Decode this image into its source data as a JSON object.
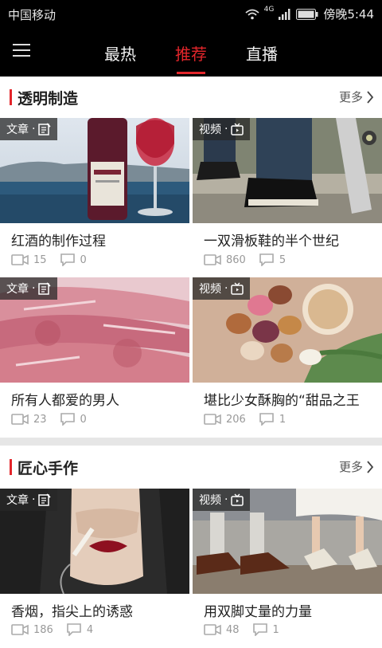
{
  "status_bar": {
    "carrier": "中国移动",
    "network": "4G",
    "time": "傍晚5:44"
  },
  "tabs": [
    {
      "label": "最热"
    },
    {
      "label": "推荐",
      "active": true
    },
    {
      "label": "直播"
    }
  ],
  "accent_color": "#e3262b",
  "sections": [
    {
      "title": "透明制造",
      "more": "更多",
      "cards": [
        {
          "type_label": "文章",
          "type_icon": "article-icon",
          "title": "红酒的制作过程",
          "views": "15",
          "comments": "0"
        },
        {
          "type_label": "视频",
          "type_icon": "tv-icon",
          "title": "一双滑板鞋的半个世纪",
          "views": "860",
          "comments": "5"
        },
        {
          "type_label": "文章",
          "type_icon": "article-icon",
          "title": "所有人都爱的男人",
          "views": "23",
          "comments": "0"
        },
        {
          "type_label": "视频",
          "type_icon": "tv-icon",
          "title": "堪比少女酥胸的“甜品之王",
          "views": "206",
          "comments": "1"
        }
      ]
    },
    {
      "title": "匠心手作",
      "more": "更多",
      "cards": [
        {
          "type_label": "文章",
          "type_icon": "article-icon",
          "title": "香烟，指尖上的诱惑",
          "views": "186",
          "comments": "4"
        },
        {
          "type_label": "视频",
          "type_icon": "tv-icon",
          "title": "用双脚丈量的力量",
          "views": "48",
          "comments": "1"
        }
      ]
    }
  ]
}
